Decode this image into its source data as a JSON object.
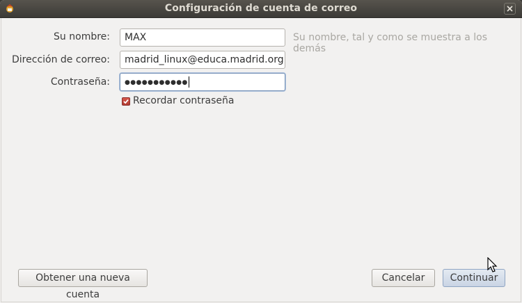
{
  "window": {
    "title": "Configuración de cuenta de correo"
  },
  "form": {
    "name_label": "Su nombre:",
    "name_value": "MAX",
    "name_hint": "Su nombre, tal y como se muestra a los demás",
    "email_label": "Dirección de correo:",
    "email_value": "madrid_linux@educa.madrid.org",
    "password_label": "Contraseña:",
    "password_mask": "●●●●●●●●●●●",
    "remember_label": "Recordar contraseña",
    "remember_checked": true
  },
  "buttons": {
    "new_account": "Obtener una nueva cuenta",
    "cancel": "Cancelar",
    "continue": "Continuar"
  },
  "icons": {
    "app": "thunderbird-icon",
    "close": "close-icon",
    "check": "check-icon",
    "pointer": "mouse-pointer-icon"
  },
  "colors": {
    "titlebar": "#3c3b37",
    "checkbox": "#c0463b",
    "primary_button": "#c9d4e4"
  }
}
